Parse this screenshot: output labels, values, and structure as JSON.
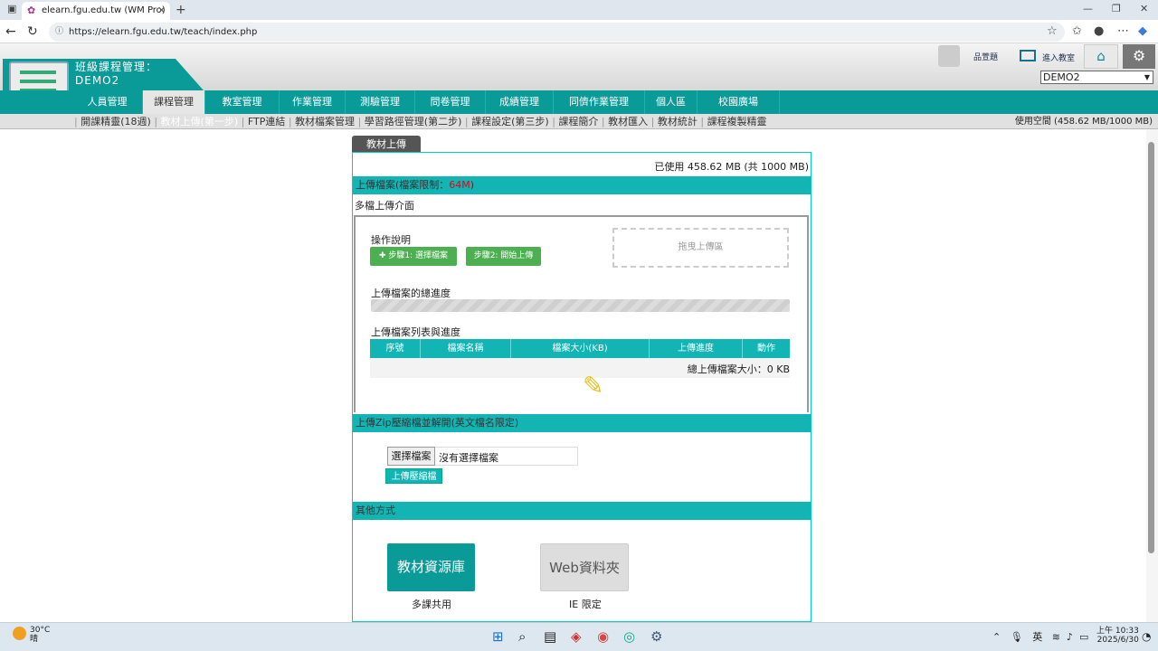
{
  "browser": {
    "tab_title": "elearn.fgu.edu.tw (WM Pro)",
    "url": "https://elearn.fgu.edu.tw/teach/index.php"
  },
  "header": {
    "title": "班級課程管理：",
    "course": "DEMO2",
    "user_label": "品萱題",
    "enter_class_label": "進入教室",
    "course_select_value": "DEMO2"
  },
  "main_menu": [
    "人員管理",
    "課程管理",
    "教室管理",
    "作業管理",
    "測驗管理",
    "問卷管理",
    "成績管理",
    "同儕作業管理",
    "個人區",
    "校園廣場"
  ],
  "sub_menu": {
    "items": [
      "開課精靈(18週)",
      "教材上傳(第一步)",
      "FTP連結",
      "教材檔案管理",
      "學習路徑管理(第二步)",
      "課程設定(第三步)",
      "課程簡介",
      "教材匯入",
      "教材統計",
      "課程複製精靈"
    ],
    "quota": "使用空間 (458.62 MB/1000 MB)"
  },
  "page": {
    "tab": "教材上傳",
    "used": "已使用 458.62 MB (共 1000 MB)",
    "upload_section": "上傳檔案(檔案限制：",
    "upload_limit": "64M",
    "upload_section_end": ")",
    "multi_title": "多檔上傳介面",
    "ops_label": "操作說明",
    "step1": "步驟1: 選擇檔案",
    "step2": "步驟2: 開始上傳",
    "drop_zone": "拖曳上傳區",
    "total_progress": "上傳檔案的總進度",
    "list_label": "上傳檔案列表與進度",
    "columns": [
      "序號",
      "檔案名稱",
      "檔案大小(KB)",
      "上傳進度",
      "動作"
    ],
    "total_size": "總上傳檔案大小：0 KB",
    "zip_section": "上傳Zip壓縮檔並解開(英文檔名限定)",
    "choose_file": "選擇檔案",
    "no_file": "沒有選擇檔案",
    "upload_zip": "上傳壓縮檔",
    "other_section": "其他方式",
    "repo_btn": "教材資源庫",
    "repo_caption": "多課共用",
    "webdav_btn": "Web資料夾",
    "webdav_caption": "IE 限定"
  },
  "taskbar": {
    "temp": "30°C",
    "weather": "晴",
    "ime": "英",
    "time": "上午 10:33",
    "date": "2025/6/30"
  },
  "accent_color": "#0a9b99"
}
